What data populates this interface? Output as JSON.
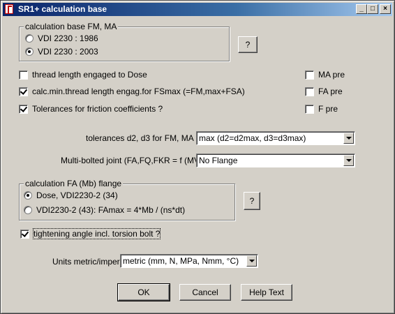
{
  "window": {
    "title": "SR1+  calculation base",
    "icon": "app-logo-icon",
    "controls": {
      "minimize": "_",
      "maximize": "□",
      "close": "×"
    }
  },
  "calc_base_group": {
    "label": "calculation base FM, MA",
    "options": [
      {
        "label": "VDI 2230 : 1986",
        "selected": false
      },
      {
        "label": "VDI 2230 : 2003",
        "selected": true
      }
    ],
    "help_button": "?"
  },
  "checkboxes_left": [
    {
      "label": "thread length engaged to Dose",
      "checked": false
    },
    {
      "label": "calc.min.thread length engag.for FSmax (=FM,max+FSA)",
      "checked": true
    },
    {
      "label": "Tolerances for friction coefficients ?",
      "checked": true
    }
  ],
  "checkboxes_right": [
    {
      "label": "MA pre",
      "checked": false
    },
    {
      "label": "FA pre",
      "checked": false
    },
    {
      "label": "F pre",
      "checked": false
    }
  ],
  "tolerances": {
    "label": "tolerances d2, d3 for FM, MA ?",
    "value": "max (d2=d2max, d3=d3max)"
  },
  "multibolted": {
    "label": "Multi-bolted joint (FA,FQ,FKR = f (MV) ?",
    "value": "No Flange"
  },
  "flange_group": {
    "label": "calculation FA (Mb) flange",
    "options": [
      {
        "label": "Dose, VDI2230-2 (34)",
        "selected": true
      },
      {
        "label": "VDI2230-2 (43): FAmax = 4*Mb / (ns*dt)",
        "selected": false
      }
    ],
    "help_button": "?"
  },
  "tightening": {
    "label": "tightening angle incl. torsion bolt ?",
    "checked": true
  },
  "units": {
    "label": "Units metric/imperial",
    "value": "metric (mm, N, MPa, Nmm, °C)"
  },
  "buttons": {
    "ok": "OK",
    "cancel": "Cancel",
    "help": "Help Text"
  }
}
